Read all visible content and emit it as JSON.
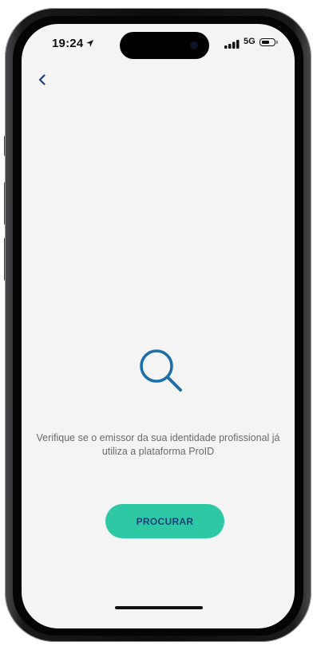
{
  "status_bar": {
    "time": "19:24",
    "network": "5G"
  },
  "colors": {
    "screen_background": "#f4f4f4",
    "accent_button": "#2ec9a4",
    "button_text": "#1d4079",
    "icon_blue": "#1f6fa8",
    "back_icon": "#1d3f7a",
    "message_text": "#6a6a6a"
  },
  "nav": {
    "back_icon": "chevron-left-icon"
  },
  "main": {
    "illustration_icon": "magnifier-icon",
    "message_line1": "Verifique se o emissor da sua identidade profissional já",
    "message_line2": "utiliza a plataforma ProID",
    "search_button_label": "PROCURAR"
  }
}
